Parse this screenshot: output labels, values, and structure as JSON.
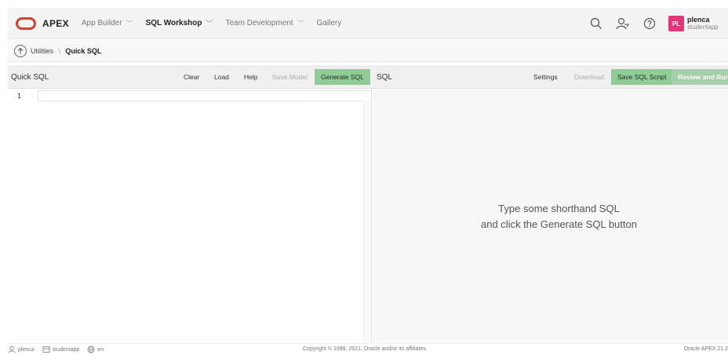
{
  "header": {
    "app_name": "APEX",
    "nav": [
      {
        "label": "App Builder",
        "has_menu": true
      },
      {
        "label": "SQL Workshop",
        "has_menu": true,
        "active": true
      },
      {
        "label": "Team Development",
        "has_menu": true
      },
      {
        "label": "Gallery",
        "has_menu": false
      }
    ],
    "user": {
      "initials": "PL",
      "name": "plenca",
      "workspace": "studentapp"
    }
  },
  "breadcrumb": {
    "items": [
      "Utilities",
      "Quick SQL"
    ]
  },
  "quick_sql": {
    "title": "Quick SQL",
    "buttons": {
      "clear": "Clear",
      "load": "Load",
      "help": "Help",
      "save_model": "Save Model",
      "generate_sql": "Generate SQL"
    },
    "editor": {
      "line_number": "1"
    }
  },
  "sql_pane": {
    "title": "SQL",
    "buttons": {
      "settings": "Settings",
      "download": "Download",
      "save_sql_script": "Save SQL Script",
      "review_and_run": "Review and Run"
    },
    "message_line1": "Type some shorthand SQL",
    "message_line2": "and click the Generate SQL button"
  },
  "footer": {
    "user": "plenca",
    "workspace": "studentapp",
    "language": "en",
    "copyright": "Copyright © 1999, 2021, Oracle and/or its affiliates.",
    "version": "Oracle APEX 21.2"
  },
  "colors": {
    "brand": "#c74634",
    "generate_button": "#8fcc96",
    "review_button": "#a5cfa9",
    "avatar": "#e0397a"
  }
}
